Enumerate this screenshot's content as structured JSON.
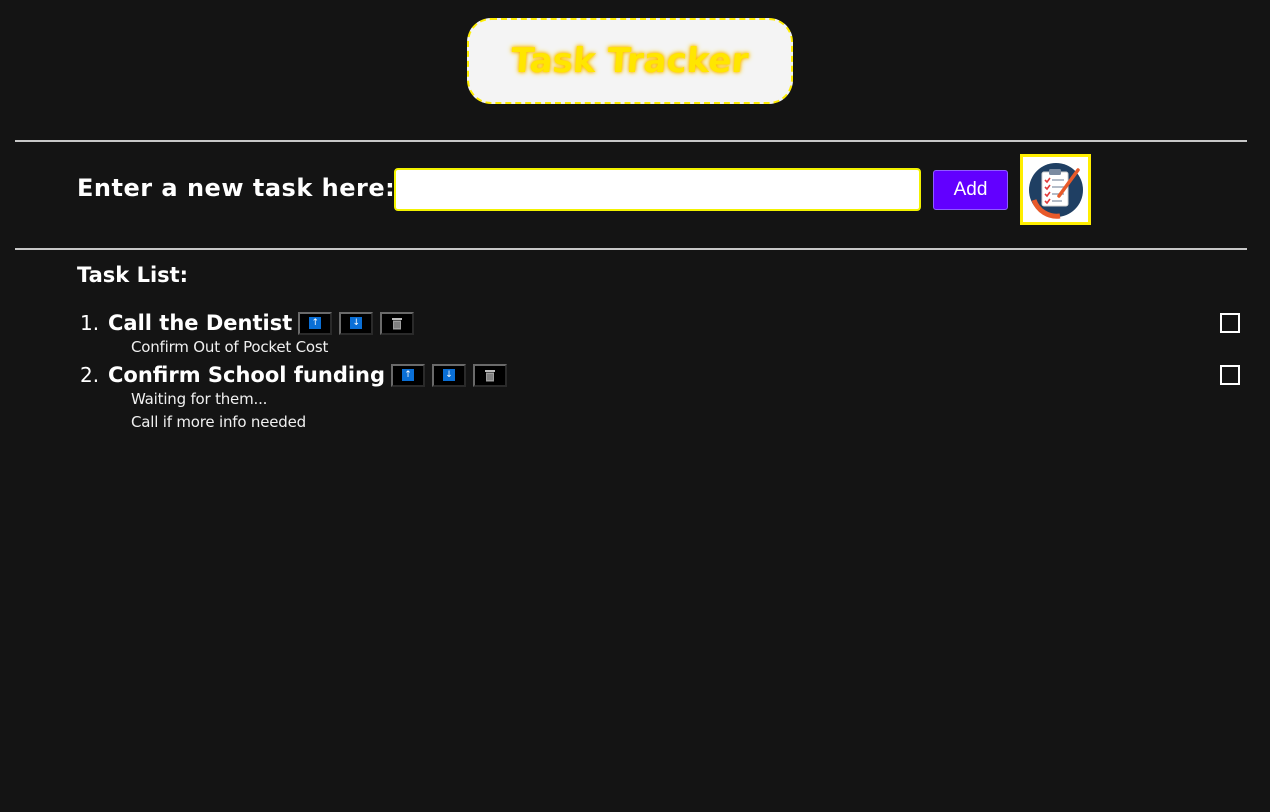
{
  "header": {
    "title": "Task Tracker"
  },
  "entry": {
    "label": "Enter a new task here:",
    "input_value": "",
    "add_label": "Add"
  },
  "logo": {
    "icon": "clipboard-checklist-icon"
  },
  "task_list": {
    "heading": "Task List:",
    "tasks": [
      {
        "number": "1.",
        "title": "Call the Dentist",
        "notes": [
          "Confirm Out of Pocket Cost"
        ],
        "checked": false
      },
      {
        "number": "2.",
        "title": "Confirm School funding",
        "notes": [
          "Waiting for them...",
          "Call if more info needed"
        ],
        "checked": false
      }
    ],
    "move_up_glyph": "↑",
    "move_down_glyph": "↓"
  },
  "colors": {
    "background": "#141414",
    "accent_yellow": "#ffee00",
    "add_button": "#6200ff",
    "arrow_blue": "#0a6fd6"
  }
}
